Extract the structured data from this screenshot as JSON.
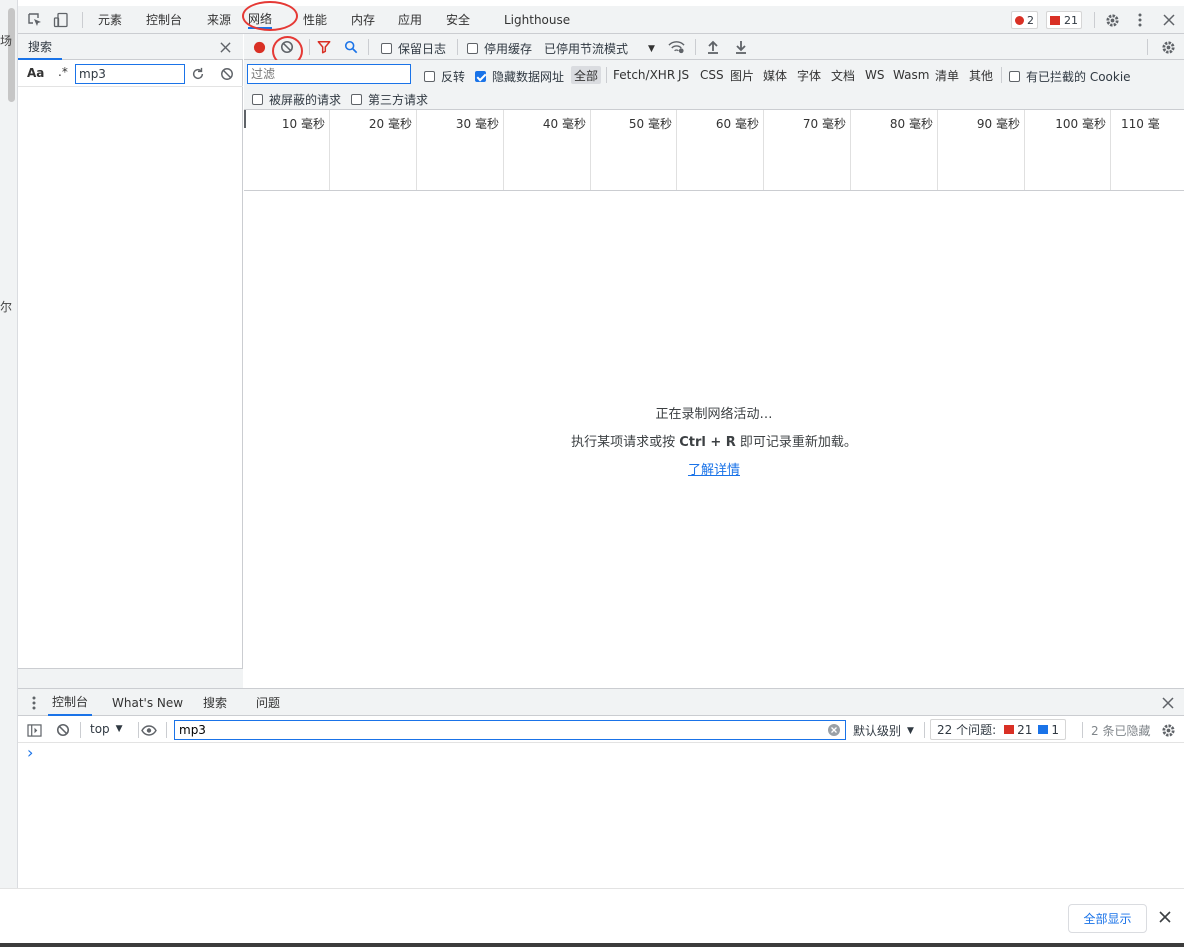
{
  "strip": {
    "char1": "场",
    "char2": "尔"
  },
  "main_tabs": [
    "元素",
    "控制台",
    "来源",
    "网络",
    "性能",
    "内存",
    "应用",
    "安全",
    "Lighthouse"
  ],
  "badges": {
    "errors": "2",
    "issues": "21"
  },
  "search_panel": {
    "tab_label": "搜索",
    "case_label": "Aa",
    "regex_label": ".*",
    "query": "mp3"
  },
  "network_toolbar": {
    "preserve_log": "保留日志",
    "disable_cache": "停用缓存",
    "throttling": "已停用节流模式"
  },
  "filter_bar": {
    "placeholder": "过滤",
    "invert": "反转",
    "hide_data_urls": "隐藏数据网址",
    "types": [
      "全部",
      "Fetch/XHR",
      "JS",
      "CSS",
      "图片",
      "媒体",
      "字体",
      "文档",
      "WS",
      "Wasm",
      "清单",
      "其他"
    ],
    "blocked_cookies": "有已拦截的 Cookie",
    "blocked_requests": "被屏蔽的请求",
    "third_party": "第三方请求"
  },
  "timeline_ticks": [
    "10 毫秒",
    "20 毫秒",
    "30 毫秒",
    "40 毫秒",
    "50 毫秒",
    "60 毫秒",
    "70 毫秒",
    "80 毫秒",
    "90 毫秒",
    "100 毫秒",
    "110 毫"
  ],
  "empty_state": {
    "line1": "正在录制网络活动…",
    "line2_prefix": "执行某项请求或按 ",
    "line2_keys": "Ctrl + R",
    "line2_suffix": " 即可记录重新加载。",
    "link": "了解详情"
  },
  "drawer_tabs": [
    "控制台",
    "What's New",
    "搜索",
    "问题"
  ],
  "console_toolbar": {
    "context": "top",
    "filter_value": "mp3",
    "levels": "默认级别",
    "issues_label": "22 个问题:",
    "issues_red": "21",
    "issues_blue": "1",
    "hidden": "2 条已隐藏"
  },
  "console": {
    "prompt": "›"
  },
  "bottom_bar": {
    "show_all": "全部显示"
  },
  "colors": {
    "accent": "#1a73e8",
    "record": "#d93025",
    "annotation": "#e53935"
  }
}
